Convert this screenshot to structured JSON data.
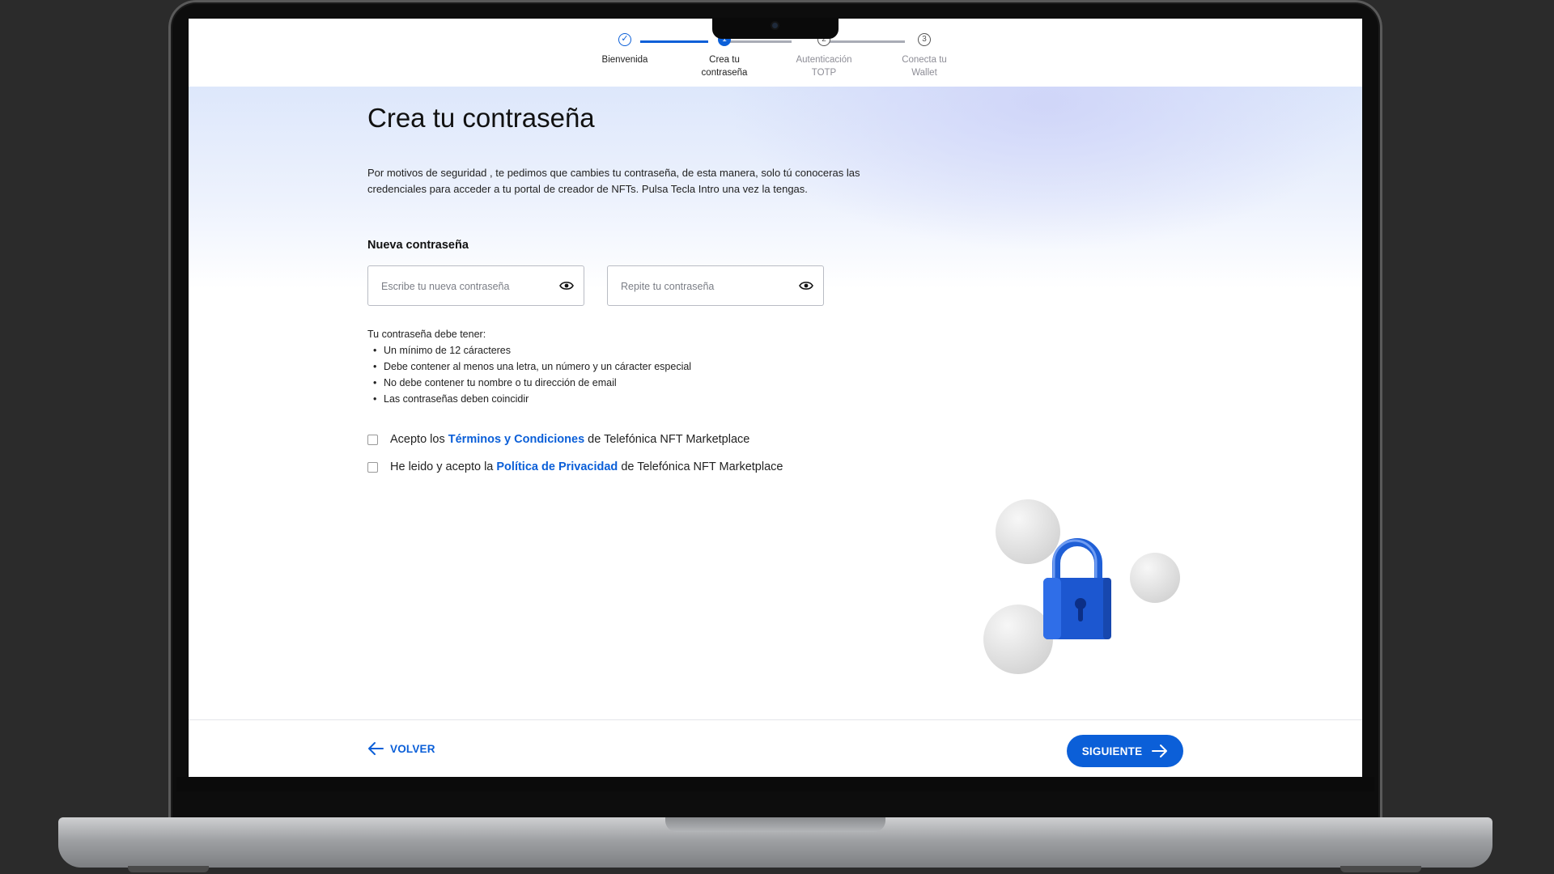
{
  "colors": {
    "accent": "#0b5fd8",
    "muted": "#8d8d96"
  },
  "stepper": {
    "steps": [
      {
        "marker": "✓",
        "label": "Bienvenida",
        "state": "done"
      },
      {
        "marker": "1",
        "label": "Crea tu\ncontraseña",
        "state": "active"
      },
      {
        "marker": "2",
        "label": "Autenticación\nTOTP",
        "state": "pending"
      },
      {
        "marker": "3",
        "label": "Conecta tu\nWallet",
        "state": "pending"
      }
    ]
  },
  "page": {
    "title": "Crea tu contraseña",
    "description": "Por motivos de seguridad , te pedimos que cambies tu contraseña, de esta manera, solo tú conoceras las credenciales para acceder a tu portal de creador de NFTs. Pulsa Tecla Intro una vez la tengas.",
    "field_label": "Nueva contraseña"
  },
  "inputs": {
    "new_password": {
      "value": "",
      "placeholder": "Escribe tu nueva contraseña",
      "icon": "eye-icon"
    },
    "repeat_password": {
      "value": "",
      "placeholder": "Repite tu contraseña",
      "icon": "eye-icon"
    }
  },
  "rules": {
    "intro": "Tu contraseña debe tener:",
    "items": [
      "Un mínimo de 12 cáracteres",
      "Debe contener al menos una letra, un número y un cáracter especial",
      "No debe contener tu nombre o tu dirección de email",
      "Las contraseñas deben coincidir"
    ]
  },
  "consents": {
    "terms": {
      "checked": false,
      "prefix": "Acepto los ",
      "link": "Términos y Condiciones",
      "suffix": " de Telefónica NFT Marketplace"
    },
    "privacy": {
      "checked": false,
      "prefix": "He leido y acepto la ",
      "link": "Política de Privacidad",
      "suffix": " de Telefónica NFT Marketplace"
    }
  },
  "footer": {
    "back_label": "VOLVER",
    "next_label": "SIGUIENTE",
    "back_icon": "arrow-left-icon",
    "next_icon": "arrow-right-icon"
  },
  "illustration": {
    "icon": "padlock-icon"
  }
}
